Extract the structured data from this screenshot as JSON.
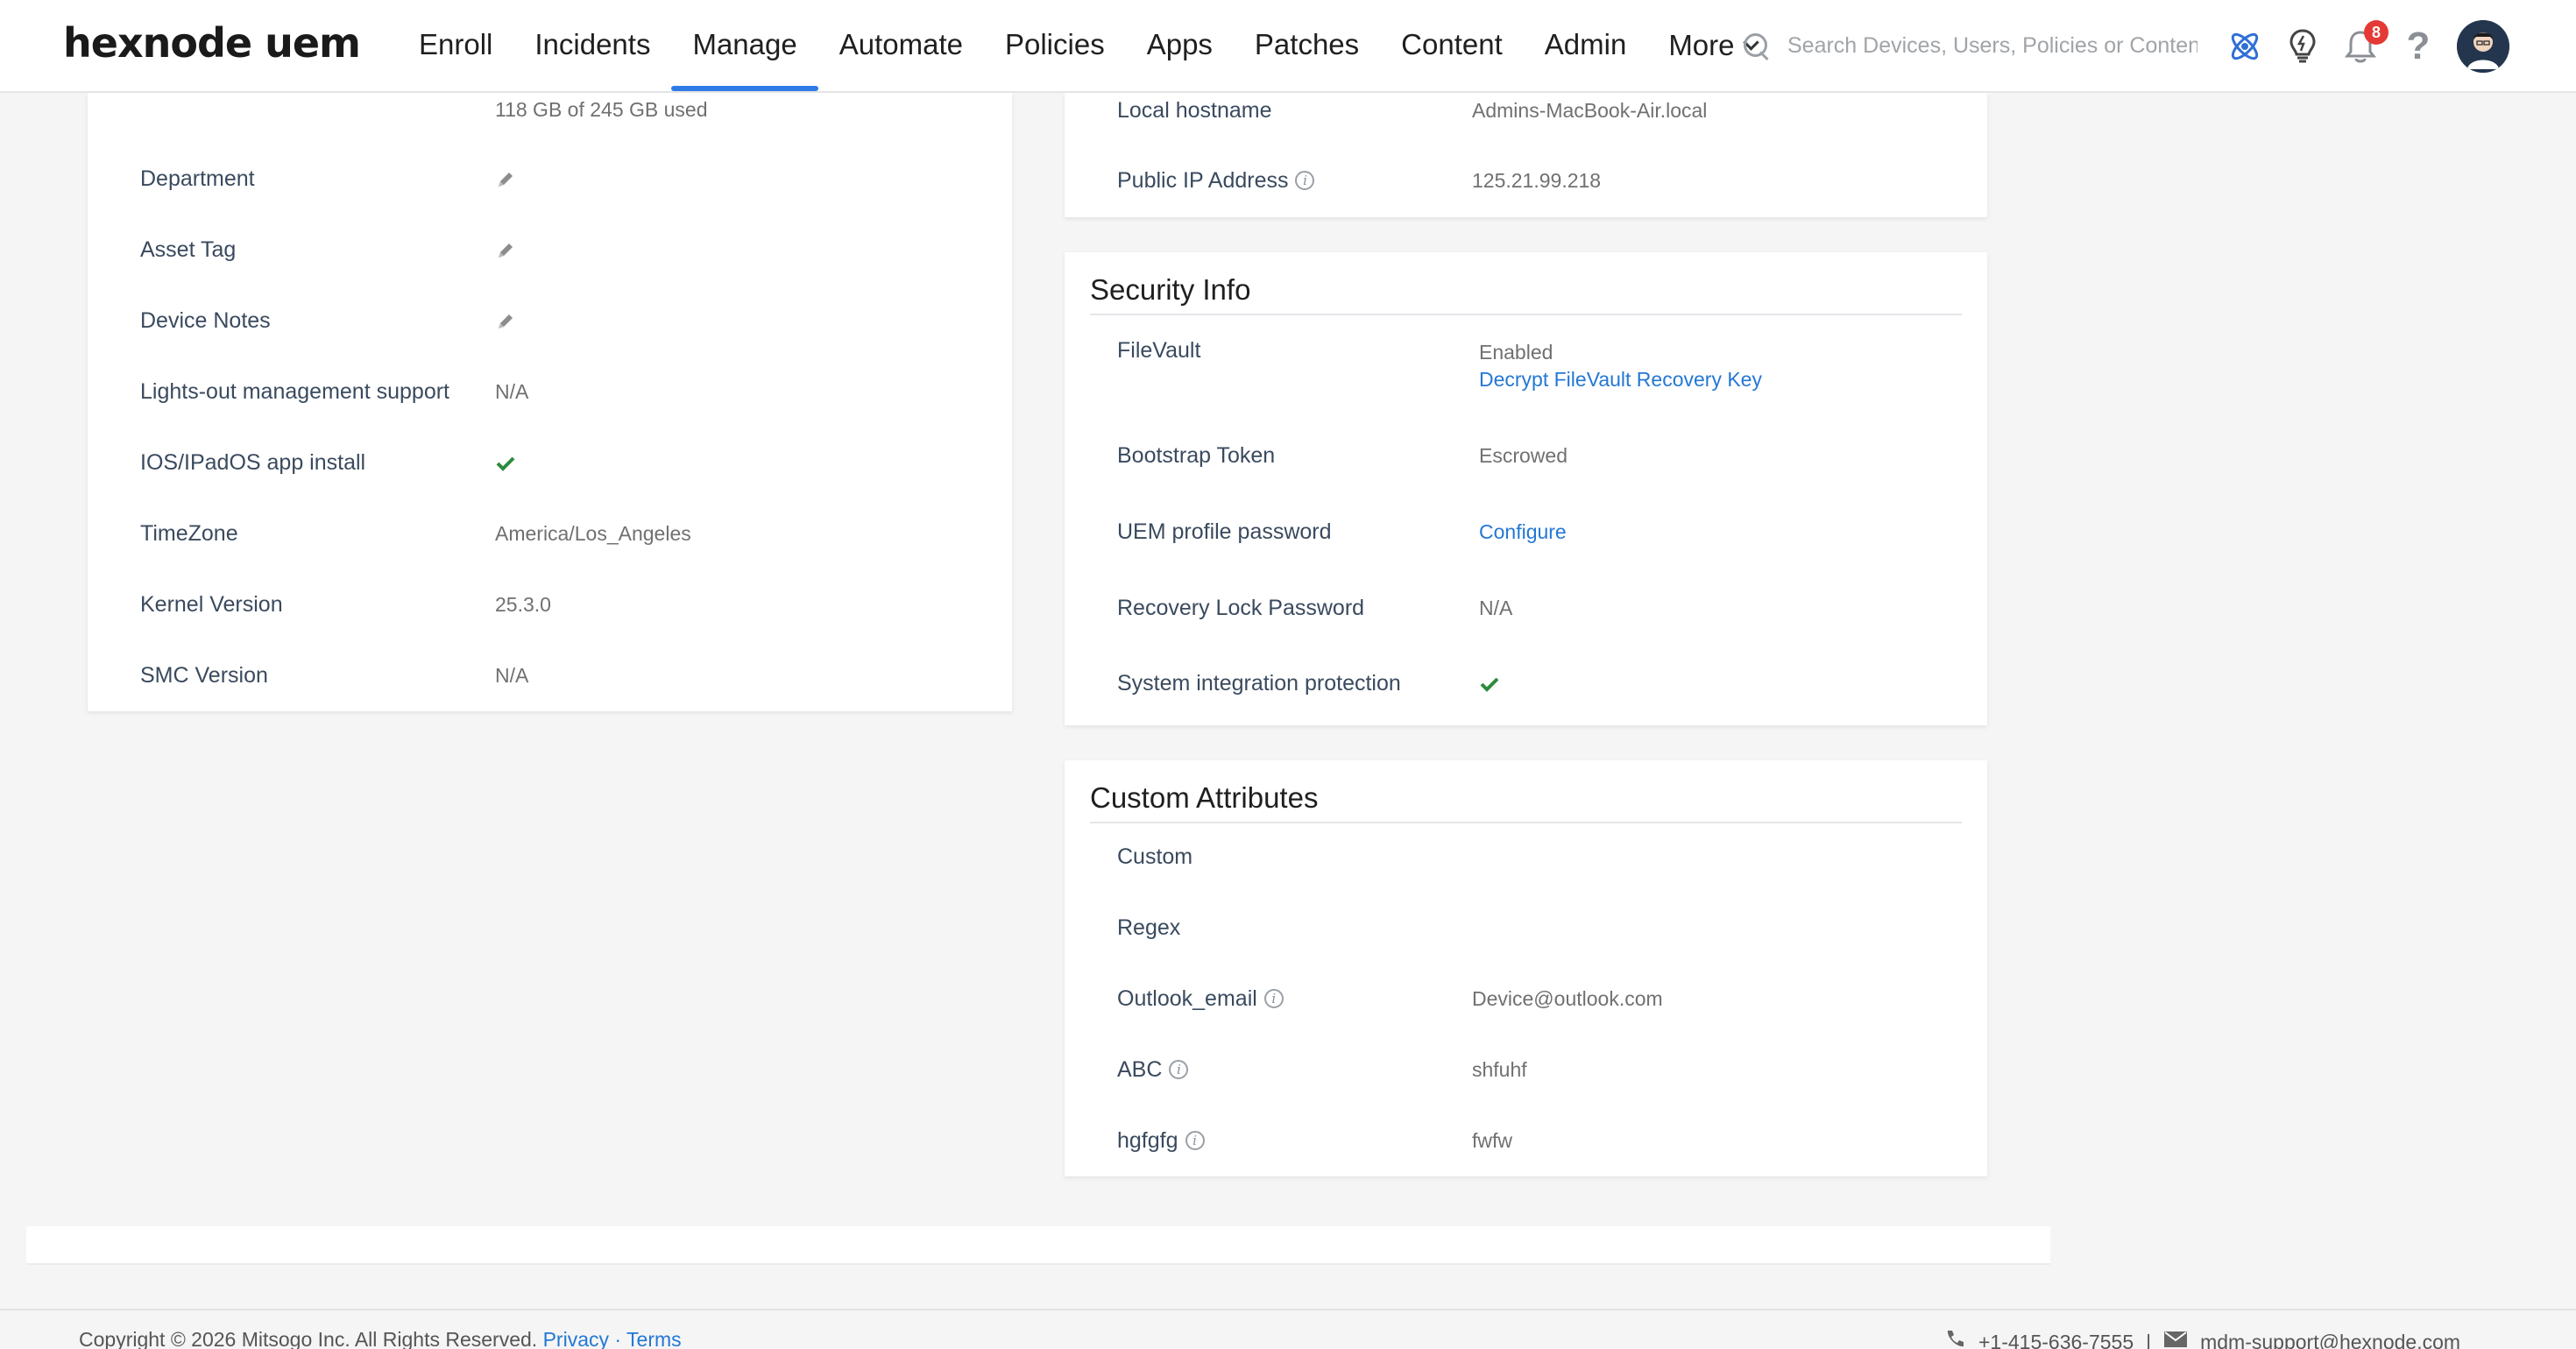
{
  "brand": {
    "name": "hexnode uem"
  },
  "nav": {
    "items": [
      {
        "label": "Enroll",
        "active": false
      },
      {
        "label": "Incidents",
        "active": false
      },
      {
        "label": "Manage",
        "active": true
      },
      {
        "label": "Automate",
        "active": false
      },
      {
        "label": "Policies",
        "active": false
      },
      {
        "label": "Apps",
        "active": false
      },
      {
        "label": "Patches",
        "active": false
      },
      {
        "label": "Content",
        "active": false
      },
      {
        "label": "Admin",
        "active": false
      }
    ],
    "more_label": "More"
  },
  "search": {
    "placeholder": "Search Devices, Users, Policies or Content"
  },
  "header_icons": {
    "atom": "atom-icon",
    "bulb": "lightbulb-icon",
    "notifications": {
      "icon": "bell-icon",
      "count": "8"
    },
    "help": "?",
    "avatar": "user-avatar"
  },
  "accent_color": "#2e7be6",
  "link_color": "#2478d4",
  "left_card": {
    "storage_value": "118 GB of 245 GB used",
    "rows": [
      {
        "label": "Department",
        "type": "edit"
      },
      {
        "label": "Asset Tag",
        "type": "edit"
      },
      {
        "label": "Device Notes",
        "type": "edit"
      },
      {
        "label": "Lights-out management support",
        "value": "N/A"
      },
      {
        "label": "IOS/IPadOS app install",
        "type": "check"
      },
      {
        "label": "TimeZone",
        "value": "America/Los_Angeles"
      },
      {
        "label": "Kernel Version",
        "value": "25.3.0"
      },
      {
        "label": "SMC Version",
        "value": "N/A"
      }
    ]
  },
  "network_card": {
    "rows": [
      {
        "label": "Local hostname",
        "value": "Admins-MacBook-Air.local"
      },
      {
        "label": "Public IP Address",
        "value": "125.21.99.218",
        "info": true
      }
    ]
  },
  "security_card": {
    "title": "Security Info",
    "filevault": {
      "label": "FileVault",
      "value": "Enabled",
      "link": "Decrypt FileVault Recovery Key"
    },
    "bootstrap": {
      "label": "Bootstrap Token",
      "value": "Escrowed"
    },
    "uem_password": {
      "label": "UEM profile password",
      "link": "Configure"
    },
    "recovery_lock": {
      "label": "Recovery Lock Password",
      "value": "N/A"
    },
    "sip": {
      "label": "System integration protection",
      "type": "check"
    }
  },
  "custom_card": {
    "title": "Custom Attributes",
    "rows": [
      {
        "label": "Custom",
        "value": ""
      },
      {
        "label": "Regex",
        "value": ""
      },
      {
        "label": "Outlook_email",
        "value": "Device@outlook.com",
        "info": true
      },
      {
        "label": "ABC",
        "value": "shfuhf",
        "info": true
      },
      {
        "label": "hgfgfg",
        "value": "fwfw",
        "info": true
      }
    ]
  },
  "footer": {
    "copyright": "Copyright © 2026 Mitsogo Inc. All Rights Reserved.",
    "privacy": "Privacy",
    "sep": "·",
    "terms": "Terms",
    "phone": "+1-415-636-7555",
    "divider": "|",
    "email": "mdm-support@hexnode.com"
  }
}
